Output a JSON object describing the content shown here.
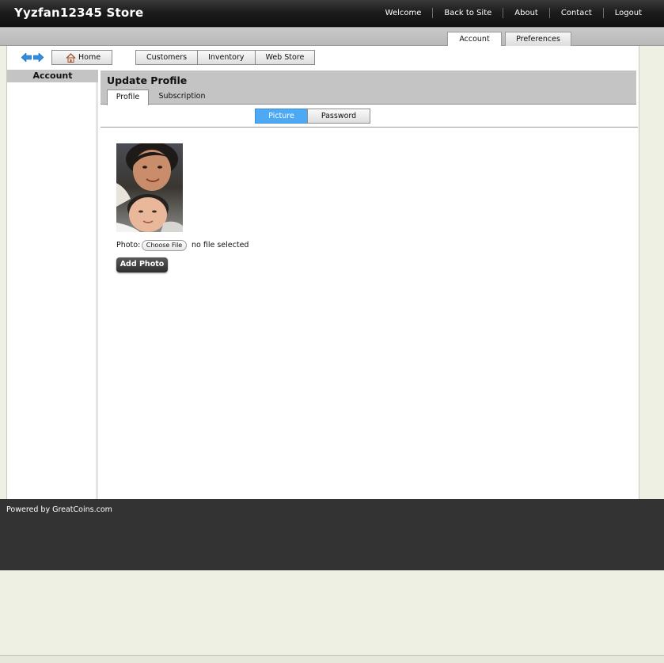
{
  "header": {
    "store_title": "Yyzfan12345 Store",
    "nav": [
      "Welcome",
      "Back to Site",
      "About",
      "Contact",
      "Logout"
    ]
  },
  "top_tabs": {
    "account": "Account",
    "preferences": "Preferences"
  },
  "toolbar": {
    "home": "Home",
    "nav": [
      "Customers",
      "Inventory",
      "Web Store"
    ]
  },
  "sidebar": {
    "title": "Account"
  },
  "panel": {
    "title": "Update Profile",
    "tabs": [
      "Profile",
      "Subscription"
    ],
    "toggle": {
      "picture": "Picture",
      "password": "Password"
    }
  },
  "photo_form": {
    "label": "Photo:",
    "choose_file": "Choose File",
    "file_status": "no file selected",
    "add_photo": "Add Photo"
  },
  "footer": {
    "text": "Powered by GreatCoins.com"
  },
  "colors": {
    "header_bg": "#1c1c1c",
    "toggle_active": "#4ea9f4",
    "footer_bg": "#333333",
    "page_bg": "#eef0e4"
  }
}
